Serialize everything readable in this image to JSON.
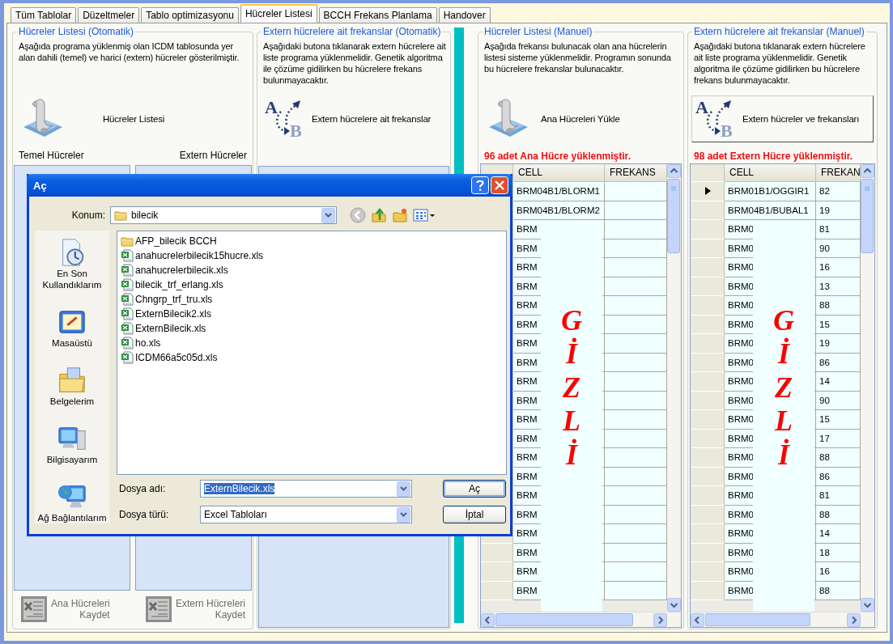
{
  "tabs": [
    {
      "label": "Tüm Tablolar",
      "selected": false
    },
    {
      "label": "Düzeltmeler",
      "selected": false
    },
    {
      "label": "Tablo optimizasyonu",
      "selected": false
    },
    {
      "label": "Hücreler Listesi",
      "selected": true
    },
    {
      "label": "BCCH Frekans Planlama",
      "selected": false
    },
    {
      "label": "Handover",
      "selected": false
    }
  ],
  "auto_cells": {
    "title": "Hücreler Listesi (Otomatik)",
    "description": "Aşağıda programa yüklenmiş olan ICDM tablosunda yer alan dahili (temel) ve harici (extern) hücreler gösterilmiştir.",
    "button": "Hücreler Listesi",
    "list_labels": [
      "Temel Hücreler",
      "Extern Hücreler"
    ],
    "save_buttons": [
      {
        "label": "Ana Hücreleri\nKaydet",
        "disabled": true
      },
      {
        "label": "Extern Hücreleri\nKaydet",
        "disabled": true
      }
    ]
  },
  "auto_extern": {
    "title": "Extern hücrelere ait frekanslar (Otomatik)",
    "description": "Aşağıdaki butona tıklanarak extern hücrelere ait liste programa yüklenmelidir. Genetik algoritma ile çözüme gidilirken bu hücrelere frekans bulunmayacaktır.",
    "button": "Extern hücrelere ait frekanslar",
    "icon_letters": [
      "A",
      "B"
    ],
    "focused": false
  },
  "manual_cells": {
    "title": "Hücreler Listesi (Manuel)",
    "description": "Aşağıda frekansı bulunacak olan ana hücrelerin listesi sisteme yüklenmelidir. Programın sonunda bu hücrelere frekanslar bulunacaktır.",
    "button": "Ana Hücreleri Yükle",
    "status": "96 adet Ana Hücre yüklenmiştir.",
    "grid": {
      "columns": [
        "CELL",
        "FREKANS"
      ],
      "mask": "GİZLİ",
      "rows": [
        {
          "cell": "BRM04B1/BLORM1"
        },
        {
          "cell": "BRM04B1/BLORM2"
        },
        {
          "cell": "BRM"
        },
        {
          "cell": "BRM"
        },
        {
          "cell": "BRM"
        },
        {
          "cell": "BRM"
        },
        {
          "cell": "BRM"
        },
        {
          "cell": "BRM"
        },
        {
          "cell": "BRM"
        },
        {
          "cell": "BRM"
        },
        {
          "cell": "BRM"
        },
        {
          "cell": "BRM"
        },
        {
          "cell": "BRM"
        },
        {
          "cell": "BRM"
        },
        {
          "cell": "BRM"
        },
        {
          "cell": "BRM"
        },
        {
          "cell": "BRM"
        },
        {
          "cell": "BRM"
        },
        {
          "cell": "BRM"
        },
        {
          "cell": "BRM"
        },
        {
          "cell": "BRM"
        },
        {
          "cell": "BRM"
        }
      ]
    }
  },
  "manual_extern": {
    "title": "Extern hücrelere ait frekanslar (Manuel)",
    "description": "Aşağıdaki butona tıklanarak extern hücrelere ait liste programa yüklenmelidir. Genetik algoritma ile çözüme gidilirken bu hücrelere frekans bulunmayacaktır.",
    "button": "Extern hücreler ve frekansları",
    "icon_letters": [
      "A",
      "B"
    ],
    "focused": true,
    "status": "98 adet Extern Hücre yüklenmiştir.",
    "grid": {
      "columns": [
        "CELL",
        "FREKAN"
      ],
      "mask": "GİZLİ",
      "rows": [
        {
          "cell": "BRM01B1/OGGIR1",
          "frekans": "82",
          "current": true
        },
        {
          "cell": "BRM04B1/BUBAL1",
          "frekans": "19",
          "current": false
        },
        {
          "cell": "BRM0",
          "frekans": "81",
          "current": false
        },
        {
          "cell": "BRM0",
          "frekans": "90",
          "current": false
        },
        {
          "cell": "BRM0",
          "frekans": "16",
          "current": false
        },
        {
          "cell": "BRM0",
          "frekans": "13",
          "current": false
        },
        {
          "cell": "BRM0",
          "frekans": "88",
          "current": false
        },
        {
          "cell": "BRM0",
          "frekans": "15",
          "current": false
        },
        {
          "cell": "BRM0",
          "frekans": "19",
          "current": false
        },
        {
          "cell": "BRM0",
          "frekans": "86",
          "current": false
        },
        {
          "cell": "BRM0",
          "frekans": "14",
          "current": false
        },
        {
          "cell": "BRM0",
          "frekans": "90",
          "current": false
        },
        {
          "cell": "BRM0",
          "frekans": "15",
          "current": false
        },
        {
          "cell": "BRM0",
          "frekans": "17",
          "current": false
        },
        {
          "cell": "BRM0",
          "frekans": "88",
          "current": false
        },
        {
          "cell": "BRM0",
          "frekans": "86",
          "current": false
        },
        {
          "cell": "BRM0",
          "frekans": "81",
          "current": false
        },
        {
          "cell": "BRM0",
          "frekans": "88",
          "current": false
        },
        {
          "cell": "BRM0",
          "frekans": "14",
          "current": false
        },
        {
          "cell": "BRM0",
          "frekans": "18",
          "current": false
        },
        {
          "cell": "BRM0",
          "frekans": "16",
          "current": false
        },
        {
          "cell": "BRM0",
          "frekans": "88",
          "current": false
        }
      ]
    }
  },
  "dialog": {
    "title": "Aç",
    "location_label": "Konum:",
    "location": "bilecik",
    "places": [
      {
        "label": "En Son Kullandıklarım",
        "kind": "recent"
      },
      {
        "label": "Masaüstü",
        "kind": "desktop"
      },
      {
        "label": "Belgelerim",
        "kind": "documents"
      },
      {
        "label": "Bilgisayarım",
        "kind": "computer"
      },
      {
        "label": "Ağ Bağlantılarım",
        "kind": "network"
      }
    ],
    "files": [
      {
        "name": "AFP_bilecik BCCH",
        "kind": "folder"
      },
      {
        "name": "anahucrelerbilecik15hucre.xls",
        "kind": "xls"
      },
      {
        "name": "anahucrelerbilecik.xls",
        "kind": "xls"
      },
      {
        "name": "bilecik_trf_erlang.xls",
        "kind": "xls"
      },
      {
        "name": "Chngrp_trf_tru.xls",
        "kind": "xls"
      },
      {
        "name": "ExternBilecik2.xls",
        "kind": "xls"
      },
      {
        "name": "ExternBilecik.xls",
        "kind": "xls"
      },
      {
        "name": "ho.xls",
        "kind": "xls"
      },
      {
        "name": "ICDM66a5c05d.xls",
        "kind": "xls"
      }
    ],
    "filename_label": "Dosya adı:",
    "filename": "ExternBilecik.xls",
    "filename_selected": true,
    "filetype_label": "Dosya türü:",
    "filetype": "Excel Tabloları",
    "buttons": [
      {
        "label": "Aç",
        "default": true
      },
      {
        "label": "İptal",
        "default": false
      }
    ]
  }
}
